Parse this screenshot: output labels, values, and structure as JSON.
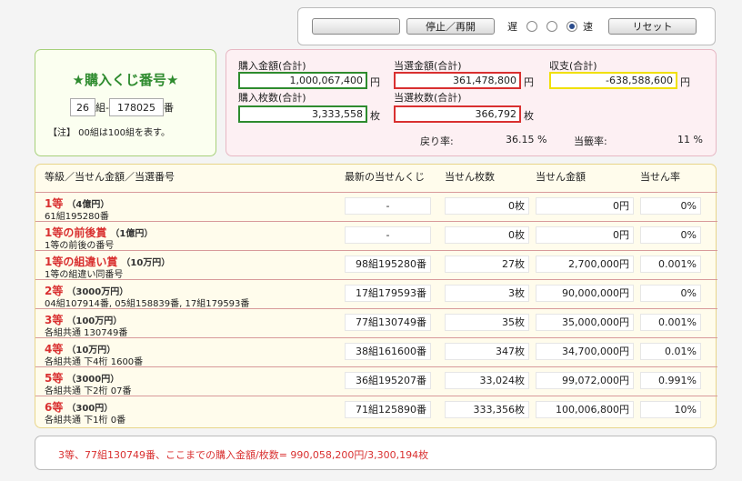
{
  "controls": {
    "blank_button": "",
    "pause_button": "停止／再開",
    "slow_label": "遅",
    "fast_label": "速",
    "speed_selected": 3,
    "reset_button": "リセット"
  },
  "ticket": {
    "title": "★購入くじ番号★",
    "group": "26",
    "group_suffix": "組-",
    "number": "178025",
    "number_suffix": "番",
    "note": "【注】 00組は100組を表す。"
  },
  "stats": {
    "purchase_amount_label": "購入金額(合計)",
    "purchase_amount": "1,000,067,400",
    "yen": "円",
    "winning_amount_label": "当選金額(合計)",
    "winning_amount": "361,478,800",
    "balance_label": "収支(合計)",
    "balance": "-638,588,600",
    "purchase_count_label": "購入枚数(合計)",
    "purchase_count": "3,333,558",
    "sheets": "枚",
    "winning_count_label": "当選枚数(合計)",
    "winning_count": "366,792",
    "return_rate_label": "戻り率:",
    "return_rate": "36.15 %",
    "win_rate_label": "当籤率:",
    "win_rate": "11 %"
  },
  "table": {
    "headers": {
      "grade": "等級／当せん金額／当選番号",
      "latest": "最新の当せんくじ",
      "count": "当せん枚数",
      "money": "当せん金額",
      "rate": "当せん率"
    },
    "rows": [
      {
        "name": "1等",
        "amount": "（4億円）",
        "sub": "61組195280番",
        "latest": "-",
        "count": "0枚",
        "money": "0円",
        "rate": "0%"
      },
      {
        "name": "1等の前後賞",
        "amount": "（1億円）",
        "sub": "1等の前後の番号",
        "latest": "-",
        "count": "0枚",
        "money": "0円",
        "rate": "0%"
      },
      {
        "name": "1等の組違い賞",
        "amount": "（10万円）",
        "sub": "1等の組違い同番号",
        "latest": "98組195280番",
        "count": "27枚",
        "money": "2,700,000円",
        "rate": "0.001%"
      },
      {
        "name": "2等",
        "amount": "（3000万円）",
        "sub": "04組107914番, 05組158839番, 17組179593番",
        "latest": "17組179593番",
        "count": "3枚",
        "money": "90,000,000円",
        "rate": "0%"
      },
      {
        "name": "3等",
        "amount": "（100万円）",
        "sub": "各組共通 130749番",
        "latest": "77組130749番",
        "count": "35枚",
        "money": "35,000,000円",
        "rate": "0.001%"
      },
      {
        "name": "4等",
        "amount": "（10万円）",
        "sub": "各組共通 下4桁 1600番",
        "latest": "38組161600番",
        "count": "347枚",
        "money": "34,700,000円",
        "rate": "0.01%"
      },
      {
        "name": "5等",
        "amount": "（3000円）",
        "sub": "各組共通 下2桁 07番",
        "latest": "36組195207番",
        "count": "33,024枚",
        "money": "99,072,000円",
        "rate": "0.991%"
      },
      {
        "name": "6等",
        "amount": "（300円）",
        "sub": "各組共通 下1桁 0番",
        "latest": "71組125890番",
        "count": "333,356枚",
        "money": "100,006,800円",
        "rate": "10%"
      }
    ]
  },
  "message": "3等、77組130749番、ここまでの購入金額/枚数= 990,058,200円/3,300,194枚"
}
